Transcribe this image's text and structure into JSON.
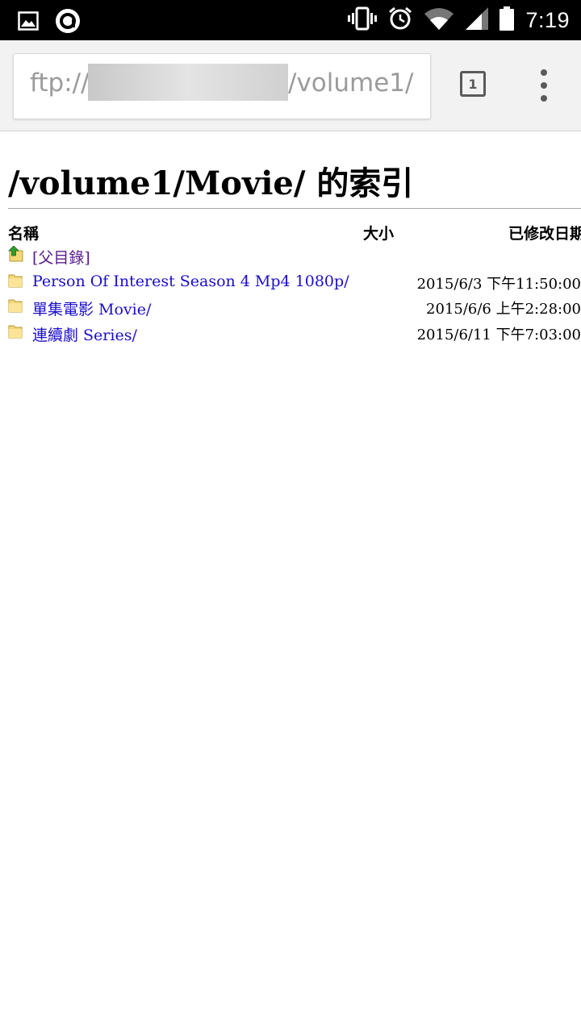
{
  "status_bar": {
    "time": "7:19",
    "left_icons": [
      "image-notification-icon",
      "assistant-notification-icon"
    ],
    "right_icons": [
      "vibrate-icon",
      "alarm-icon",
      "wifi-icon",
      "signal-icon",
      "battery-icon"
    ]
  },
  "toolbar": {
    "url_prefix": "ftp://",
    "url_suffix": "/volume1/",
    "tab_count": "1"
  },
  "page": {
    "title": "/volume1/Movie/ 的索引",
    "columns": {
      "name": "名稱",
      "size": "大小",
      "modified": "已修改日期"
    },
    "parent": {
      "label": "[父目錄]"
    },
    "rows": [
      {
        "name": "Person Of Interest Season 4 Mp4 1080p/",
        "size": "",
        "date": "2015/6/3 下午11:50:00"
      },
      {
        "name": "單集電影 Movie/",
        "size": "",
        "date": "2015/6/6 上午2:28:00"
      },
      {
        "name": "連續劇 Series/",
        "size": "",
        "date": "2015/6/11 下午7:03:00"
      }
    ]
  },
  "colors": {
    "link": "#1a0dcc",
    "visited_link": "#551a8b",
    "folder": "#f5d777",
    "status_bar": "#000000",
    "toolbar": "#f2f2f2"
  }
}
